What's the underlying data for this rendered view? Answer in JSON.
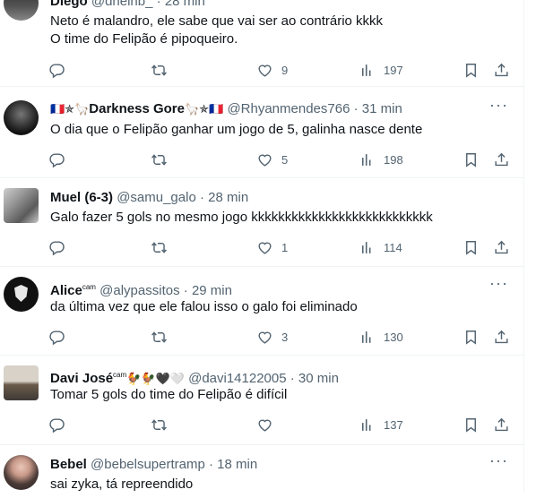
{
  "tweets": [
    {
      "name": "Diego",
      "handle": "@dnelnb_",
      "time": "28 min",
      "text": "Neto é malandro, ele sabe que vai ser ao contrário kkkk\nO time do Felipão é pipoqueiro.",
      "replies": "",
      "retweets": "",
      "likes": "9",
      "views": "197"
    },
    {
      "name_prefix": "🇫🇷✯🦙",
      "name": "Darkness Gore",
      "name_suffix": "🦙✯🇫🇷",
      "handle": "@Rhyanmendes766",
      "time": "31 min",
      "text": "O dia que o Felipão ganhar um jogo de 5, galinha nasce dente",
      "replies": "",
      "retweets": "",
      "likes": "5",
      "views": "198"
    },
    {
      "name": "Muel (6-3)",
      "handle": "@samu_galo",
      "time": "28 min",
      "text": "Galo fazer 5 gols no mesmo jogo kkkkkkkkkkkkkkkkkkkkkkkkkkk",
      "replies": "",
      "retweets": "",
      "likes": "1",
      "views": "114"
    },
    {
      "name": "Alice",
      "name_sup": "cam",
      "handle": "@alypassitos",
      "time": "29 min",
      "text": "da última vez que ele falou isso o galo foi eliminado",
      "replies": "",
      "retweets": "",
      "likes": "3",
      "views": "130"
    },
    {
      "name": "Davi José",
      "name_sup": "cam",
      "name_suffix": "🐓🐓🖤🤍",
      "handle": "@davi14122005",
      "time": "30 min",
      "text": "Tomar 5 gols do time do Felipão é difícil",
      "replies": "",
      "retweets": "",
      "likes": "",
      "views": "137"
    },
    {
      "name": "Bebel",
      "handle": "@bebelsupertramp",
      "time": "18 min",
      "text": "sai zyka, tá repreendido",
      "replies": "",
      "retweets": "",
      "likes": "",
      "views": ""
    }
  ],
  "dot": "·",
  "more_glyph": "···",
  "colors": {
    "text": "#0f1419",
    "secondary": "#536471",
    "border": "#eff3f4"
  },
  "icons": [
    "reply-icon",
    "retweet-icon",
    "like-icon",
    "views-icon",
    "bookmark-icon",
    "share-icon",
    "more-icon"
  ]
}
